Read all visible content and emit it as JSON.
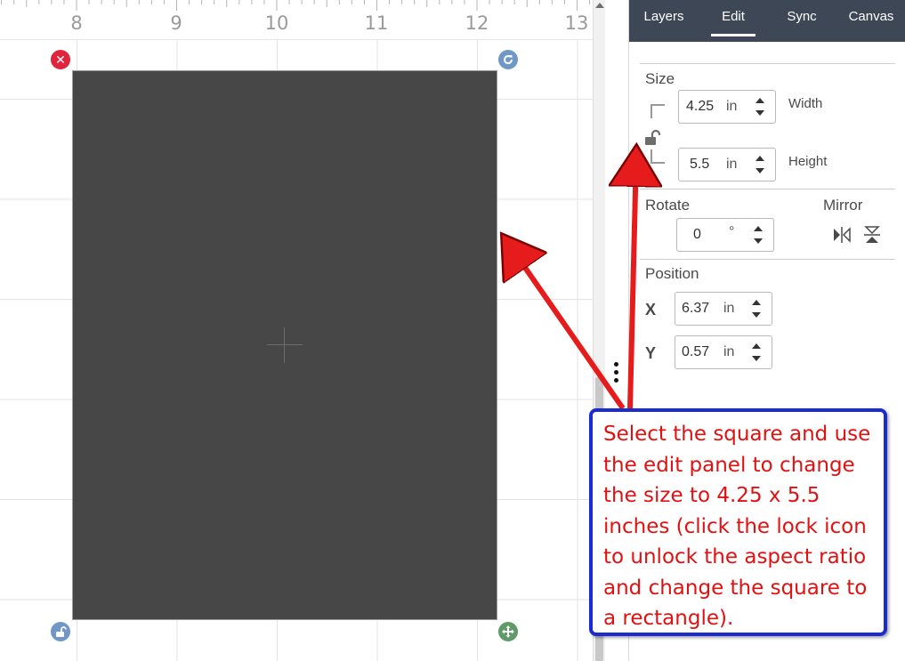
{
  "ruler": {
    "labels": [
      "8",
      "9",
      "10",
      "11",
      "12",
      "13"
    ]
  },
  "tabs": [
    {
      "label": "Layers",
      "active": false
    },
    {
      "label": "Edit",
      "active": true
    },
    {
      "label": "Sync",
      "active": false
    },
    {
      "label": "Canvas",
      "active": false
    }
  ],
  "edit_panel": {
    "size": {
      "label": "Size",
      "width": {
        "value": "4.25",
        "unit": "in",
        "label": "Width"
      },
      "height": {
        "value": "5.5",
        "unit": "in",
        "label": "Height"
      },
      "aspect_lock": "unlocked"
    },
    "rotate": {
      "label": "Rotate",
      "value": "0",
      "unit": "°"
    },
    "mirror": {
      "label": "Mirror"
    },
    "position": {
      "label": "Position",
      "x": {
        "label": "X",
        "value": "6.37",
        "unit": "in"
      },
      "y": {
        "label": "Y",
        "value": "0.57",
        "unit": "in"
      }
    }
  },
  "annotation": {
    "text": "Select the square and use the edit panel to change the size to 4.25 x 5.5 inches (click the lock icon to unlock the aspect ratio and change the square to a rectangle).",
    "border_color": "#1a2ccf",
    "text_color": "#e21111",
    "arrow_color": "#e61b1b"
  },
  "colors": {
    "tab_bar": "#3d4756",
    "shape_fill": "#474747",
    "handle_delete": "#e0243b",
    "handle_blue": "#6f98c7",
    "handle_green": "#5e9b68"
  }
}
